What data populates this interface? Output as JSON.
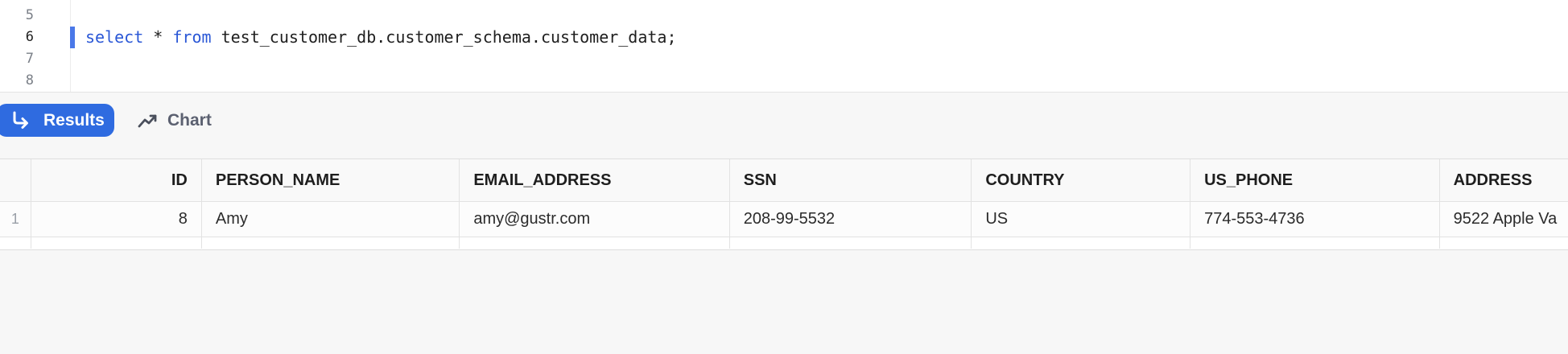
{
  "editor": {
    "lines": [
      {
        "number": "5",
        "code": ""
      },
      {
        "number": "6",
        "code": "select * from test_customer_db.customer_schema.customer_data;"
      },
      {
        "number": "7",
        "code": ""
      },
      {
        "number": "8",
        "code": ""
      }
    ],
    "active_line": "6",
    "tokens": {
      "kw_select": "select",
      "star": " * ",
      "kw_from": "from",
      "rest": " test_customer_db.customer_schema.customer_data;"
    },
    "keyword_color": "#2a57d6"
  },
  "toolbar": {
    "results_label": "Results",
    "results_icon": "return-arrow-icon",
    "chart_label": "Chart",
    "chart_icon": "line-chart-icon",
    "active_tab": "Results",
    "accent_color": "#2f6be0"
  },
  "table": {
    "columns": [
      "",
      "ID",
      "PERSON_NAME",
      "EMAIL_ADDRESS",
      "SSN",
      "COUNTRY",
      "US_PHONE",
      "ADDRESS"
    ],
    "rows": [
      [
        "1",
        "8",
        "Amy",
        "amy@gustr.com",
        "208-99-5532",
        "US",
        "774-553-4736",
        "9522 Apple Va"
      ]
    ]
  }
}
